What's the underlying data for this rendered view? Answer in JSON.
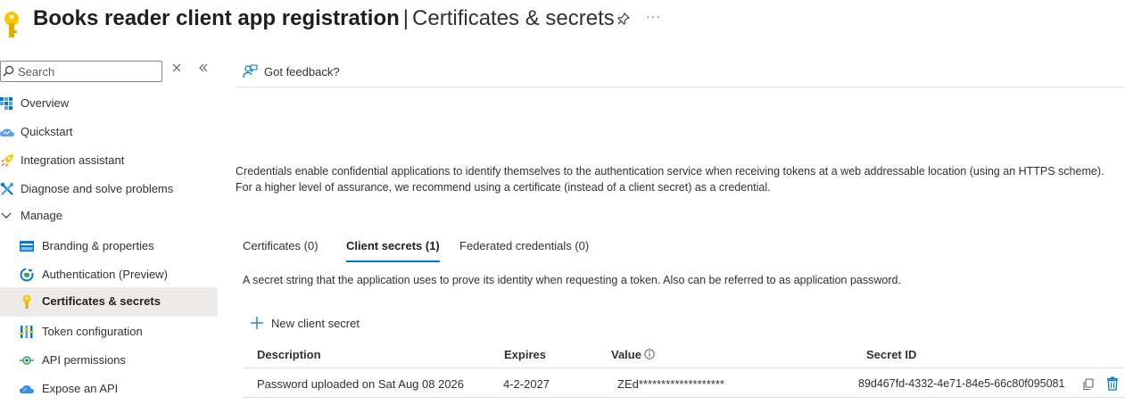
{
  "header": {
    "title_strong": "Books reader client app registration",
    "separator": "|",
    "title_sub": "Certificates & secrets",
    "more": "···"
  },
  "sidebar": {
    "search_placeholder": "Search",
    "items": [
      {
        "label": "Overview",
        "icon": "overview-grid-icon"
      },
      {
        "label": "Quickstart",
        "icon": "quickstart-cloud-icon"
      },
      {
        "label": "Integration assistant",
        "icon": "rocket-icon"
      },
      {
        "label": "Diagnose and solve problems",
        "icon": "wrench-icon"
      },
      {
        "label": "Manage",
        "icon": "chevron-down-icon"
      },
      {
        "label": "Branding & properties",
        "icon": "branding-card-icon"
      },
      {
        "label": "Authentication (Preview)",
        "icon": "authentication-icon"
      },
      {
        "label": "Certificates & secrets",
        "icon": "key-icon",
        "active": true
      },
      {
        "label": "Token configuration",
        "icon": "token-bars-icon"
      },
      {
        "label": "API permissions",
        "icon": "api-permissions-icon"
      },
      {
        "label": "Expose an API",
        "icon": "cloud-icon"
      }
    ]
  },
  "toolbar": {
    "feedback": "Got feedback?"
  },
  "intro": "Credentials enable confidential applications to identify themselves to the authentication service when receiving tokens at a web addressable location (using an HTTPS scheme). For a higher level of assurance, we recommend using a certificate (instead of a client secret) as a credential.",
  "tabs": [
    {
      "label": "Certificates (0)"
    },
    {
      "label": "Client secrets (1)",
      "active": true
    },
    {
      "label": "Federated credentials (0)"
    }
  ],
  "tab_description": "A secret string that the application uses to prove its identity when requesting a token. Also can be referred to as application password.",
  "new_secret_label": "New client secret",
  "table": {
    "headers": [
      "Description",
      "Expires",
      "Value",
      "Secret ID"
    ],
    "rows": [
      {
        "description": "Password uploaded on Sat Aug 08 2026",
        "expires": "4-2-2027",
        "value": "ZEd*******************",
        "secret_id": "89d467fd-4332-4e71-84e5-66c80f095081"
      }
    ]
  },
  "colors": {
    "accent": "#0078d4",
    "key_yellow": "#f8c700",
    "active_bg": "#edebe9",
    "border": "#e1dfdd"
  }
}
